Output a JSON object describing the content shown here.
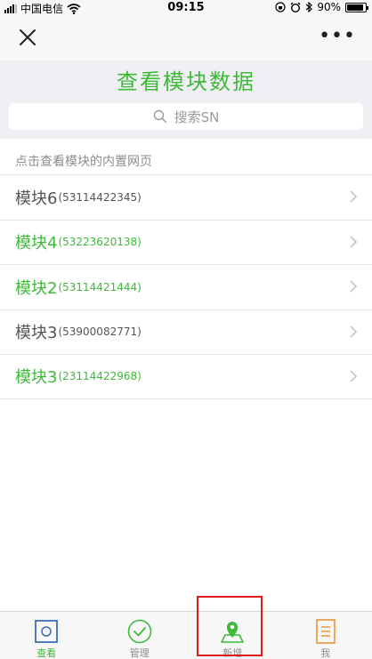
{
  "status_bar": {
    "carrier": "中国电信",
    "time": "09:15",
    "battery": "90%",
    "battery_fraction": 0.9
  },
  "nav": {
    "close_icon": "close-icon",
    "more_icon": "more-icon",
    "more_label": "•••"
  },
  "page": {
    "title": "查看模块数据"
  },
  "search": {
    "placeholder": "搜索SN"
  },
  "list": {
    "hint": "点击查看模块的内置网页",
    "items": [
      {
        "name": "模块6",
        "sn": "(53114422345)",
        "color": "gray"
      },
      {
        "name": "模块4",
        "sn": "(53223620138)",
        "color": "green"
      },
      {
        "name": "模块2",
        "sn": "(53114421444)",
        "color": "green"
      },
      {
        "name": "模块3",
        "sn": "(53900082771)",
        "color": "gray"
      },
      {
        "name": "模块3",
        "sn": "(23114422968)",
        "color": "green"
      }
    ]
  },
  "tabs": [
    {
      "label": "查看",
      "icon": "view-icon",
      "active": true
    },
    {
      "label": "管理",
      "icon": "manage-icon",
      "active": false
    },
    {
      "label": "新增",
      "icon": "add-location-icon",
      "active": false
    },
    {
      "label": "我",
      "icon": "profile-icon",
      "active": false
    }
  ],
  "colors": {
    "accent": "#3fb93a",
    "gray_text": "#555555",
    "tab_blue": "#3c6fb6",
    "tab_orange": "#e8953a",
    "highlight": "#e01b1b"
  }
}
